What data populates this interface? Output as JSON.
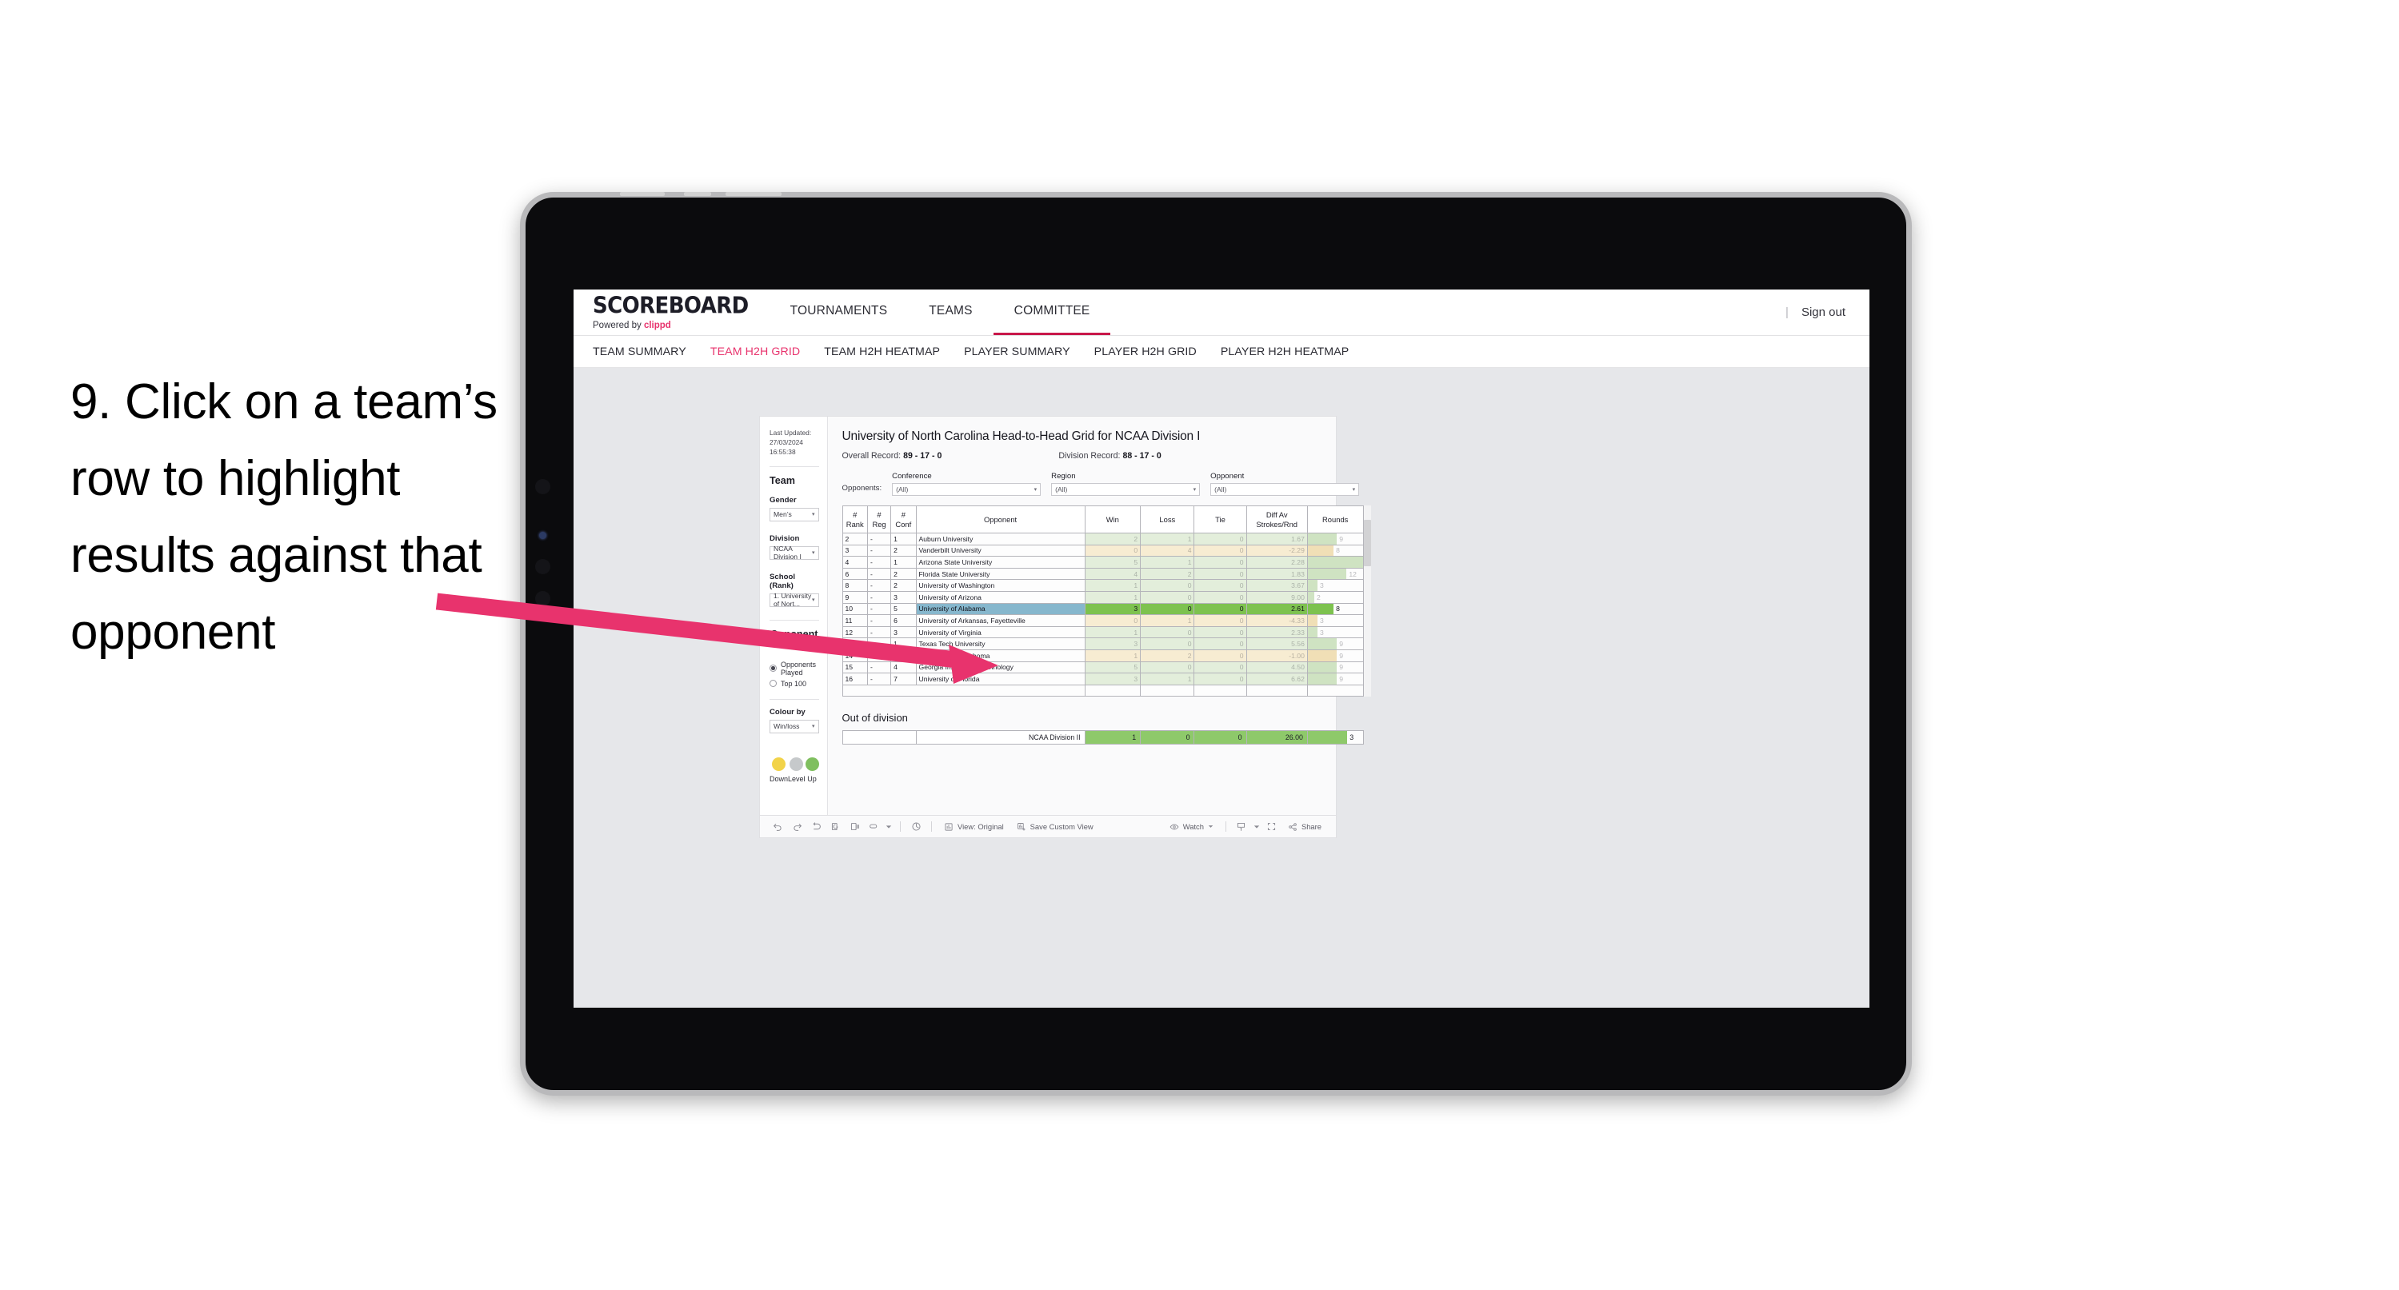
{
  "annotation": {
    "text": "9. Click on a team’s row to highlight results against that opponent",
    "arrow_color": "#E8336D"
  },
  "app": {
    "brand": {
      "name": "SCOREBOARD",
      "powered_prefix": "Powered by ",
      "powered_brand": "clippd"
    },
    "top_nav": [
      {
        "label": "TOURNAMENTS",
        "active": false
      },
      {
        "label": "TEAMS",
        "active": false
      },
      {
        "label": "COMMITTEE",
        "active": true
      }
    ],
    "sign_out": "Sign out",
    "sub_nav": [
      {
        "label": "TEAM SUMMARY",
        "active": false
      },
      {
        "label": "TEAM H2H GRID",
        "active": true
      },
      {
        "label": "TEAM H2H HEATMAP",
        "active": false
      },
      {
        "label": "PLAYER SUMMARY",
        "active": false
      },
      {
        "label": "PLAYER H2H GRID",
        "active": false
      },
      {
        "label": "PLAYER H2H HEATMAP",
        "active": false
      }
    ]
  },
  "sidebar": {
    "last_updated": "Last Updated: 27/03/2024 16:55:38",
    "team_heading": "Team",
    "gender_label": "Gender",
    "gender_value": "Men’s",
    "division_label": "Division",
    "division_value": "NCAA Division I",
    "school_label": "School (Rank)",
    "school_value": "1. University of Nort...",
    "opponent_view_heading": "Opponent View",
    "opponent_view_options": [
      {
        "label": "Opponents Played",
        "selected": true
      },
      {
        "label": "Top 100",
        "selected": false
      }
    ],
    "colour_by_label": "Colour by",
    "colour_by_value": "Win/loss",
    "legend": [
      {
        "label": "Down",
        "color": "#F2D349"
      },
      {
        "label": "Level",
        "color": "#C6C9CB"
      },
      {
        "label": "Up",
        "color": "#7FBF5F"
      }
    ]
  },
  "main": {
    "title": "University of North Carolina Head-to-Head Grid for NCAA Division I",
    "overall_record_label": "Overall Record: ",
    "overall_record_value": "89 - 17 - 0",
    "division_record_label": "Division Record: ",
    "division_record_value": "88 - 17 - 0",
    "opponents_label": "Opponents:",
    "filters": [
      {
        "name": "Conference",
        "value": "(All)"
      },
      {
        "name": "Region",
        "value": "(All)"
      },
      {
        "name": "Opponent",
        "value": "(All)"
      }
    ]
  },
  "chart_data": {
    "type": "table",
    "title": "University of North Carolina Head-to-Head Grid for NCAA Division I",
    "columns": [
      "# Rank",
      "# Reg",
      "# Conf",
      "Opponent",
      "Win",
      "Loss",
      "Tie",
      "Diff Av Strokes/Rnd",
      "Rounds"
    ],
    "column_headers_multiline": [
      [
        "#",
        "Rank"
      ],
      [
        "#",
        "Reg"
      ],
      [
        "#",
        "Conf"
      ],
      [
        "Opponent"
      ],
      [
        "Win"
      ],
      [
        "Loss"
      ],
      [
        "Tie"
      ],
      [
        "Diff Av",
        "Strokes/Rnd"
      ],
      [
        "Rounds"
      ]
    ],
    "rounds_max": 17,
    "rows": [
      {
        "rank": "2",
        "reg": "-",
        "conf": "1",
        "opponent": "Auburn University",
        "win": "2",
        "loss": "1",
        "tie": "0",
        "diff": "1.67",
        "rounds": 9,
        "tone": "up",
        "selected": false
      },
      {
        "rank": "3",
        "reg": "-",
        "conf": "2",
        "opponent": "Vanderbilt University",
        "win": "0",
        "loss": "4",
        "tie": "0",
        "diff": "-2.29",
        "rounds": 8,
        "tone": "down",
        "selected": false
      },
      {
        "rank": "4",
        "reg": "-",
        "conf": "1",
        "opponent": "Arizona State University",
        "win": "5",
        "loss": "1",
        "tie": "0",
        "diff": "2.28",
        "rounds": 17,
        "tone": "up",
        "selected": false
      },
      {
        "rank": "6",
        "reg": "-",
        "conf": "2",
        "opponent": "Florida State University",
        "win": "4",
        "loss": "2",
        "tie": "0",
        "diff": "1.83",
        "rounds": 12,
        "tone": "up",
        "selected": false
      },
      {
        "rank": "8",
        "reg": "-",
        "conf": "2",
        "opponent": "University of Washington",
        "win": "1",
        "loss": "0",
        "tie": "0",
        "diff": "3.67",
        "rounds": 3,
        "tone": "up",
        "selected": false
      },
      {
        "rank": "9",
        "reg": "-",
        "conf": "3",
        "opponent": "University of Arizona",
        "win": "1",
        "loss": "0",
        "tie": "0",
        "diff": "9.00",
        "rounds": 2,
        "tone": "up",
        "selected": false
      },
      {
        "rank": "10",
        "reg": "-",
        "conf": "5",
        "opponent": "University of Alabama",
        "win": "3",
        "loss": "0",
        "tie": "0",
        "diff": "2.61",
        "rounds": 8,
        "tone": "up",
        "selected": true
      },
      {
        "rank": "11",
        "reg": "-",
        "conf": "6",
        "opponent": "University of Arkansas, Fayetteville",
        "win": "0",
        "loss": "1",
        "tie": "0",
        "diff": "-4.33",
        "rounds": 3,
        "tone": "down",
        "selected": false
      },
      {
        "rank": "12",
        "reg": "-",
        "conf": "3",
        "opponent": "University of Virginia",
        "win": "1",
        "loss": "0",
        "tie": "0",
        "diff": "2.33",
        "rounds": 3,
        "tone": "up",
        "selected": false
      },
      {
        "rank": "13",
        "reg": "-",
        "conf": "1",
        "opponent": "Texas Tech University",
        "win": "3",
        "loss": "0",
        "tie": "0",
        "diff": "5.56",
        "rounds": 9,
        "tone": "up",
        "selected": false
      },
      {
        "rank": "14",
        "reg": "-",
        "conf": "2",
        "opponent": "University of Oklahoma",
        "win": "1",
        "loss": "2",
        "tie": "0",
        "diff": "-1.00",
        "rounds": 9,
        "tone": "down",
        "selected": false
      },
      {
        "rank": "15",
        "reg": "-",
        "conf": "4",
        "opponent": "Georgia Institute of Technology",
        "win": "5",
        "loss": "0",
        "tie": "0",
        "diff": "4.50",
        "rounds": 9,
        "tone": "up",
        "selected": false
      },
      {
        "rank": "16",
        "reg": "-",
        "conf": "7",
        "opponent": "University of Florida",
        "win": "3",
        "loss": "1",
        "tie": "0",
        "diff": "6.62",
        "rounds": 9,
        "tone": "up",
        "selected": false
      }
    ],
    "out_of_division": {
      "heading": "Out of division",
      "label": "NCAA Division II",
      "win": "1",
      "loss": "0",
      "tie": "0",
      "diff": "26.00",
      "rounds": "3"
    }
  },
  "toolbar": {
    "view_label": "View: Original",
    "save_label": "Save Custom View",
    "watch_label": "Watch",
    "share_label": "Share"
  }
}
